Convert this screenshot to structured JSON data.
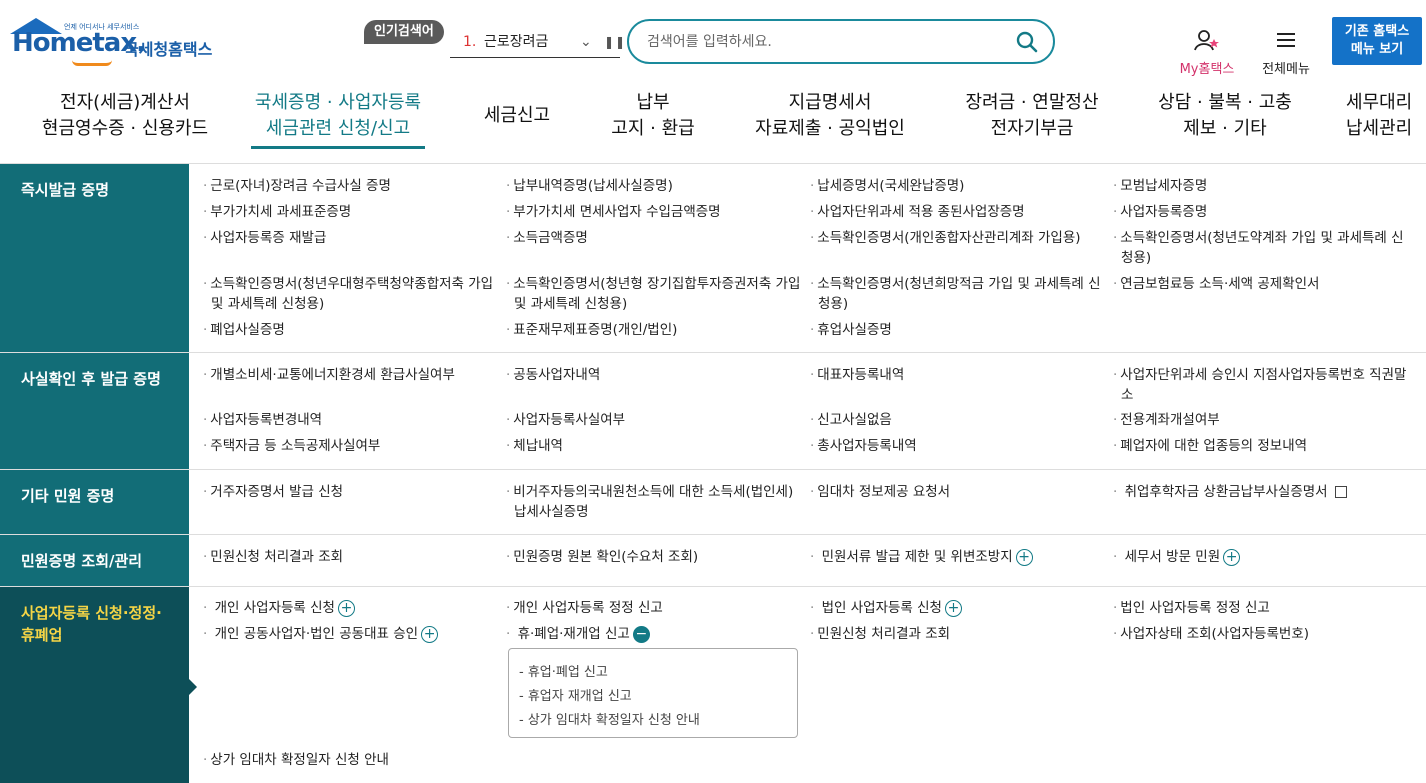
{
  "header": {
    "logo_word": "Hometax.",
    "logo_tiny": "언제 어디서나 세무서비스",
    "logo_kor": "국세청홈택스",
    "popular_label": "인기검색어",
    "popular_num": "1.",
    "popular_term": "근로장려금",
    "search_placeholder": "검색어를 입력하세요.",
    "my_hometax": "My홈택스",
    "all_menu": "전체메뉴",
    "classic_line1": "기존 홈택스",
    "classic_line2": "메뉴 보기"
  },
  "nav": [
    {
      "l1": "전자(세금)계산서",
      "l2": "현금영수증 · 신용카드"
    },
    {
      "l1": "국세증명 · 사업자등록",
      "l2": "세금관련 신청/신고"
    },
    {
      "l1": "세금신고",
      "l2": ""
    },
    {
      "l1": "납부",
      "l2": "고지 · 환급"
    },
    {
      "l1": "지급명세서",
      "l2": "자료제출 · 공익법인"
    },
    {
      "l1": "장려금 · 연말정산",
      "l2": "전자기부금"
    },
    {
      "l1": "상담 · 불복 · 고충",
      "l2": "제보 · 기타"
    },
    {
      "l1": "세무대리",
      "l2": "납세관리"
    }
  ],
  "sections": {
    "s1": {
      "title": "즉시발급 증명",
      "items": [
        "근로(자녀)장려금 수급사실 증명",
        "납부내역증명(납세사실증명)",
        "납세증명서(국세완납증명)",
        "모범납세자증명",
        "부가가치세 과세표준증명",
        "부가가치세 면세사업자 수입금액증명",
        "사업자단위과세 적용 종된사업장증명",
        "사업자등록증명",
        "사업자등록증 재발급",
        "소득금액증명",
        "소득확인증명서(개인종합자산관리계좌 가입용)",
        "소득확인증명서(청년도약계좌 가입 및 과세특례 신",
        "청용)",
        "소득확인증명서(청년우대형주택청약종합저축 가입",
        "및 과세특례 신청용)",
        "소득확인증명서(청년형 장기집합투자증권저축 가입",
        "및 과세특례 신청용)",
        "소득확인증명서(청년희망적금 가입 및 과세특례 신",
        "청용)",
        "연금보험료등 소득·세액 공제확인서",
        "폐업사실증명",
        "표준재무제표증명(개인/법인)",
        "휴업사실증명"
      ]
    },
    "s2": {
      "title": "사실확인 후 발급 증명",
      "items": [
        "개별소비세·교통에너지환경세 환급사실여부",
        "공동사업자내역",
        "대표자등록내역",
        "사업자단위과세 승인시 지점사업자등록번호 직권말",
        "소",
        "사업자등록변경내역",
        "사업자등록사실여부",
        "신고사실없음",
        "전용계좌개설여부",
        "주택자금 등 소득공제사실여부",
        "체납내역",
        "총사업자등록내역",
        "폐업자에 대한 업종등의 정보내역"
      ]
    },
    "s3": {
      "title": "기타 민원 증명",
      "items": [
        "거주자증명서 발급 신청",
        "비거주자등의국내원천소득에 대한 소득세(법인세)",
        "납세사실증명",
        "임대차 정보제공 요청서",
        "취업후학자금 상환금납부사실증명서"
      ]
    },
    "s4": {
      "title": "민원증명 조회/관리",
      "items": [
        "민원신청 처리결과 조회",
        "민원증명 원본 확인(수요처 조회)",
        "민원서류 발급 제한 및 위변조방지",
        "세무서 방문 민원"
      ]
    },
    "s5": {
      "title_l1": "사업자등록 신청·정정·",
      "title_l2": "휴폐업",
      "items": [
        "개인 사업자등록 신청",
        "개인 사업자등록 정정 신고",
        "법인 사업자등록 신청",
        "법인 사업자등록 정정 신고",
        "개인 공동사업자·법인 공동대표 승인",
        "휴·폐업·재개업 신고",
        "민원신청 처리결과 조회",
        "사업자상태 조회(사업자등록번호)",
        "상가 임대차 확정일자 신청 안내"
      ],
      "submenu": [
        "- 휴업·폐업 신고",
        "- 휴업자 재개업 신고",
        "- 상가 임대차 확정일자 신청 안내"
      ]
    }
  },
  "colors": {
    "teal": "#126d77",
    "teal_dark": "#0d4f58",
    "accent_yellow": "#f5d546",
    "brand_blue": "#1472c8",
    "pink": "#d3336b"
  }
}
